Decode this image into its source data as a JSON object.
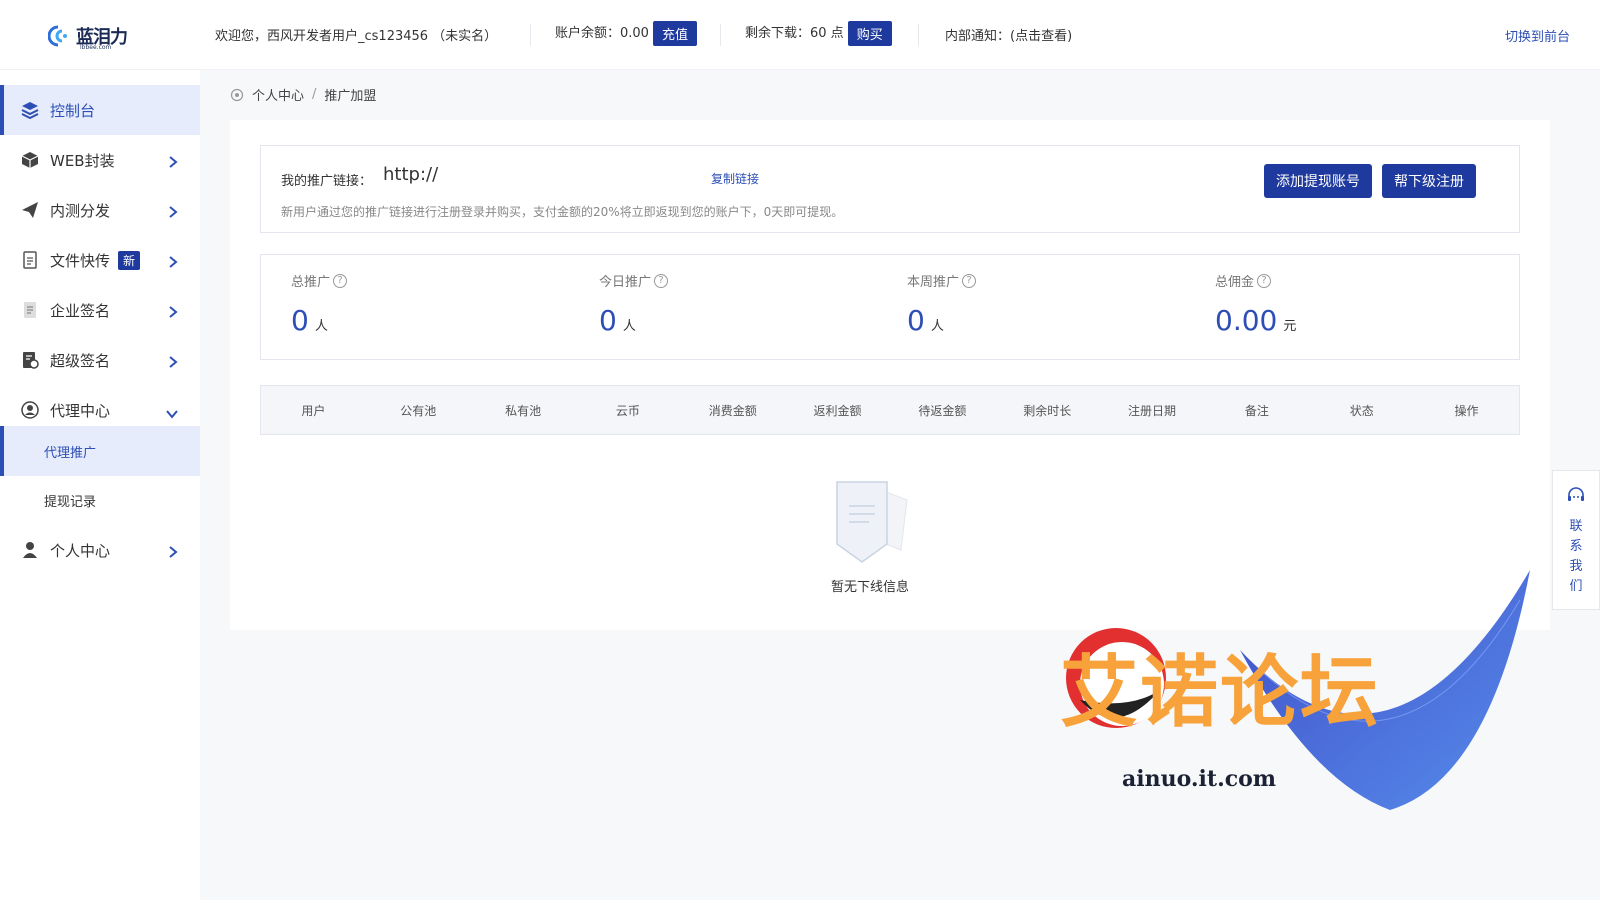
{
  "header": {
    "logo_text": "蓝泪力",
    "logo_sub": "lbbee.com",
    "welcome": "欢迎您，西风开发者用户_cs123456 （未实名）",
    "balance_label": "账户余额：0.00",
    "recharge_btn": "充值",
    "downloads_label": "剩余下载：60 点",
    "buy_btn": "购买",
    "notice": "内部通知：(点击查看)",
    "switch_front": "切换到前台"
  },
  "sidebar": {
    "items": [
      {
        "label": "控制台",
        "icon": "layers-icon"
      },
      {
        "label": "WEB封装",
        "icon": "box-icon"
      },
      {
        "label": "内测分发",
        "icon": "send-icon"
      },
      {
        "label": "文件快传",
        "icon": "file-icon",
        "badge": "新"
      },
      {
        "label": "企业签名",
        "icon": "doc-icon"
      },
      {
        "label": "超级签名",
        "icon": "cert-icon"
      },
      {
        "label": "代理中心",
        "icon": "agent-icon"
      },
      {
        "label": "个人中心",
        "icon": "user-icon"
      }
    ],
    "sub_items": [
      {
        "label": "代理推广"
      },
      {
        "label": "提现记录"
      }
    ]
  },
  "breadcrumb": {
    "parent": "个人中心",
    "sep": "/",
    "current": "推广加盟"
  },
  "promo": {
    "link_label": "我的推广链接：",
    "link_url": "http://",
    "copy_link": "复制链接",
    "description": "新用户通过您的推广链接进行注册登录并购买，支付金额的20%将立即返现到您的账户下，0天即可提现。",
    "add_withdraw_btn": "添加提现账号",
    "help_register_btn": "帮下级注册"
  },
  "stats": [
    {
      "label": "总推广",
      "value": "0",
      "unit": "人"
    },
    {
      "label": "今日推广",
      "value": "0",
      "unit": "人"
    },
    {
      "label": "本周推广",
      "value": "0",
      "unit": "人"
    },
    {
      "label": "总佣金",
      "value": "0.00",
      "unit": "元"
    }
  ],
  "table": {
    "columns": [
      "用户",
      "公有池",
      "私有池",
      "云币",
      "消费金额",
      "返利金额",
      "待返金额",
      "剩余时长",
      "注册日期",
      "备注",
      "状态",
      "操作"
    ],
    "empty_text": "暂无下线信息"
  },
  "contact": {
    "label": "联系我们"
  },
  "watermark": {
    "text": "艾诺论坛",
    "url": "ainuo.it.com"
  },
  "colors": {
    "primary": "#1f3a9e",
    "accent": "#2d4fb5",
    "active_bg": "#e6ecfb",
    "watermark": "#f7a23a"
  }
}
